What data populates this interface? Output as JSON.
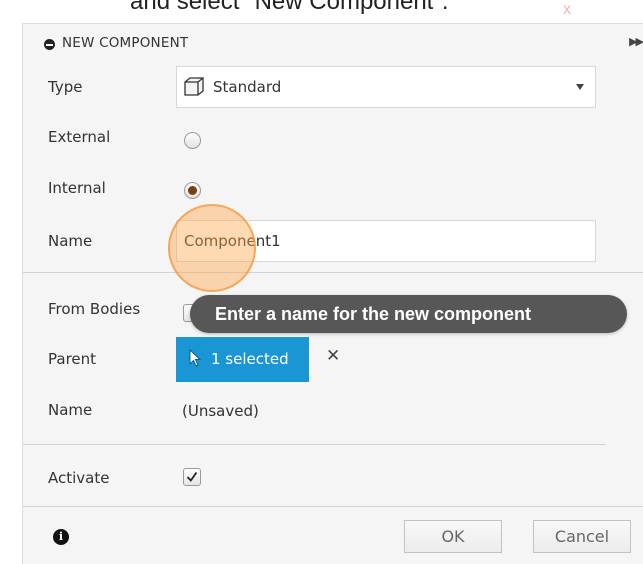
{
  "caption": {
    "text": "and select \"New Component\".",
    "mark": "x"
  },
  "dialog": {
    "title": "NEW COMPONENT",
    "icons": {
      "title": "minus-circle-icon",
      "expand": "double-chevron-right-icon",
      "type": "cube-icon",
      "select": "cursor-arrow-icon",
      "clear": "close-icon",
      "info": "info-icon"
    },
    "rows": {
      "type_label": "Type",
      "type_value": "Standard",
      "external_label": "External",
      "internal_label": "Internal",
      "name_label": "Name",
      "name_value": "Component1",
      "from_bodies_label": "From Bodies",
      "parent_label": "Parent",
      "parent_selection": "1 selected",
      "clear_glyph": "✕",
      "saved_name_label": "Name",
      "saved_name_value": "(Unsaved)",
      "activate_label": "Activate"
    },
    "radios": {
      "external_checked": false,
      "internal_checked": true
    },
    "activate_checked": true,
    "buttons": {
      "ok": "OK",
      "cancel": "Cancel"
    },
    "tooltip": "Enter a name for the new component"
  },
  "colors": {
    "selection_button": "#1a96d4",
    "tooltip_bg": "#575757",
    "click_highlight": "#f5963c"
  }
}
